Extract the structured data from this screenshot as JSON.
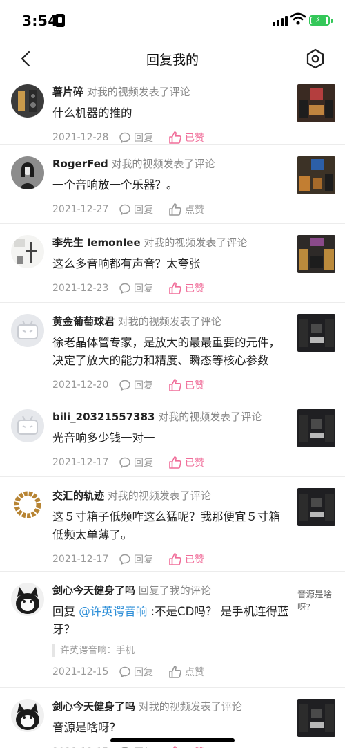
{
  "status": {
    "time": "3:54"
  },
  "nav": {
    "title": "回复我的"
  },
  "items": [
    {
      "username": "薯片碎",
      "action": "对我的视频发表了评论",
      "comment": "什么机器的推的",
      "date": "2021-12-28",
      "reply_label": "回复",
      "like_label": "已赞",
      "liked": true
    },
    {
      "username": "RogerFed",
      "action": "对我的视频发表了评论",
      "comment": "一个音响放一个乐器？。",
      "date": "2021-12-27",
      "reply_label": "回复",
      "like_label": "点赞",
      "liked": false
    },
    {
      "username": "李先生 lemonlee",
      "action": "对我的视频发表了评论",
      "comment": "这么多音响都有声音？太夸张",
      "date": "2021-12-23",
      "reply_label": "回复",
      "like_label": "已赞",
      "liked": true
    },
    {
      "username": "黄金葡萄球君",
      "action": "对我的视频发表了评论",
      "comment": "徐老晶体管专家，是放大的最最重要的元件，决定了放大的能力和精度、瞬态等核心参数",
      "date": "2021-12-20",
      "reply_label": "回复",
      "like_label": "已赞",
      "liked": true
    },
    {
      "username": "bili_20321557383",
      "action": "对我的视频发表了评论",
      "comment": "光音响多少钱一对一",
      "date": "2021-12-17",
      "reply_label": "回复",
      "like_label": "已赞",
      "liked": true
    },
    {
      "username": "交汇的轨迹",
      "action": "对我的视频发表了评论",
      "comment": "这５寸箱子低频咋这么猛呢？我那便宜５寸箱低频太单薄了。",
      "date": "2021-12-17",
      "reply_label": "回复",
      "like_label": "已赞",
      "liked": true
    },
    {
      "username": "剑心今天健身了吗",
      "action": "回复了我的评论",
      "reply_prefix": "回复 ",
      "mention": "@许英谔音响",
      "comment": " :不是CD吗？ 是手机连得蓝牙？",
      "quote": "许英谔音响：手机",
      "date": "2021-12-15",
      "reply_label": "回复",
      "like_label": "点赞",
      "liked": false,
      "side_text": "音源是啥呀?"
    },
    {
      "username": "剑心今天健身了吗",
      "action": "对我的视频发表了评论",
      "comment": "音源是啥呀?",
      "date": "2021-12-15",
      "reply_label": "回复",
      "like_label": "已赞",
      "liked": true
    }
  ],
  "colors": {
    "accent_pink": "#f06d99",
    "mention_blue": "#2e8fd8",
    "battery_green": "#34c759"
  }
}
